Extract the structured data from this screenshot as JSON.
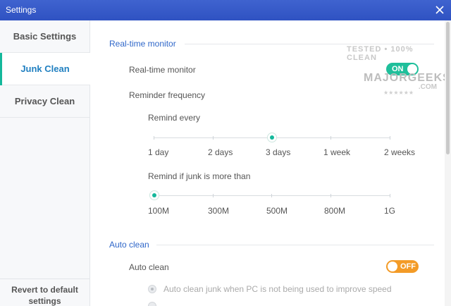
{
  "window": {
    "title": "Settings"
  },
  "sidebar": {
    "items": [
      {
        "label": "Basic Settings",
        "active": false
      },
      {
        "label": "Junk Clean",
        "active": true
      },
      {
        "label": "Privacy Clean",
        "active": false
      }
    ],
    "revert_label_line1": "Revert to default",
    "revert_label_line2": "settings"
  },
  "realtime": {
    "section_title": "Real-time monitor",
    "monitor_label": "Real-time monitor",
    "monitor_toggle": "ON",
    "reminder_label": "Reminder frequency",
    "remind_every_label": "Remind every",
    "remind_every_options": [
      "1 day",
      "2 days",
      "3 days",
      "1 week",
      "2 weeks"
    ],
    "remind_every_selected": "3 days",
    "remind_junk_label": "Remind if junk is more than",
    "remind_junk_options": [
      "100M",
      "300M",
      "500M",
      "800M",
      "1G"
    ],
    "remind_junk_selected": "100M"
  },
  "autoclean": {
    "section_title": "Auto clean",
    "autoclean_label": "Auto clean",
    "autoclean_toggle": "OFF",
    "option1_label": "Auto clean junk when PC is not being used to improve speed"
  },
  "watermark": {
    "top": "TESTED • 100% CLEAN",
    "main": "MAJORGEEKS",
    "com": ".COM",
    "stars": "★★★★★★"
  },
  "colors": {
    "titlebar": "#3257c6",
    "accent_green": "#14b89b",
    "toggle_off": "#f39b27",
    "section_title": "#2f67c9"
  }
}
